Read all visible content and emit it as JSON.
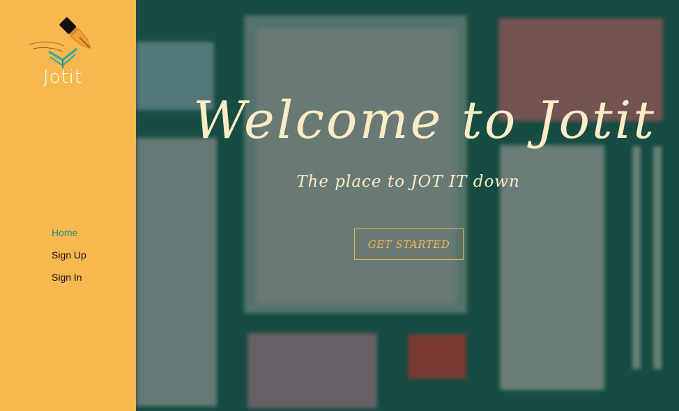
{
  "brand": {
    "name": "Jotit"
  },
  "nav": {
    "items": [
      {
        "label": "Home",
        "active": true
      },
      {
        "label": "Sign Up",
        "active": false
      },
      {
        "label": "Sign In",
        "active": false
      }
    ]
  },
  "hero": {
    "title": "Welcome to Jotit",
    "subtitle": "The place to JOT IT down",
    "cta_label": "GET STARTED"
  },
  "colors": {
    "sidebar": "#f9b84f",
    "accent_text": "#fbecc6",
    "cta": "#f4b84f",
    "active_nav": "#2e8a78",
    "background": "#1f5a4e"
  },
  "icons": {
    "logo": "fountain-pen-icon"
  }
}
